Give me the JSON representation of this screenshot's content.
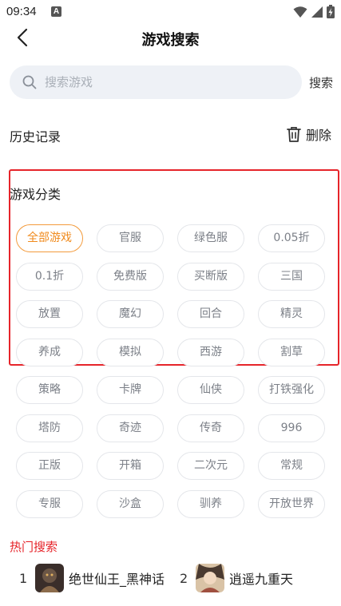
{
  "status_bar": {
    "time": "09:34",
    "notification_letter": "A"
  },
  "nav": {
    "title": "游戏搜索"
  },
  "search": {
    "placeholder": "搜索游戏",
    "button_label": "搜索"
  },
  "history": {
    "title": "历史记录",
    "delete_label": "删除"
  },
  "categories": {
    "title": "游戏分类",
    "active_index": 0,
    "tags": [
      "全部游戏",
      "官服",
      "绿色服",
      "0.05折",
      "0.1折",
      "免费版",
      "买断版",
      "三国",
      "放置",
      "魔幻",
      "回合",
      "精灵",
      "养成",
      "模拟",
      "西游",
      "割草",
      "策略",
      "卡牌",
      "仙侠",
      "打铁强化",
      "塔防",
      "奇迹",
      "传奇",
      "996",
      "正版",
      "开箱",
      "二次元",
      "常规",
      "专服",
      "沙盒",
      "驯养",
      "开放世界"
    ]
  },
  "hot_search": {
    "title": "热门搜索",
    "items": [
      {
        "rank": "1",
        "name": "绝世仙王_黑神话"
      },
      {
        "rank": "2",
        "name": "逍遥九重天"
      }
    ]
  },
  "colors": {
    "accent_orange": "#f08a1c",
    "highlight_red": "#e6242a",
    "search_bg": "#eef1f6"
  }
}
